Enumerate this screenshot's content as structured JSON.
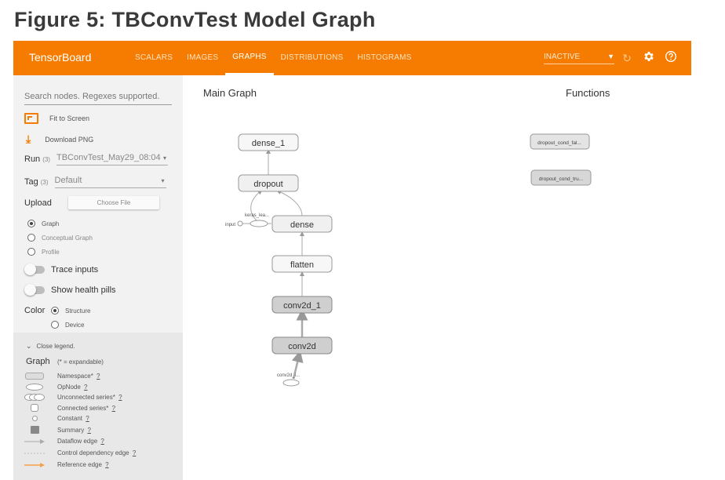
{
  "figure_title": "Figure 5:  TBConvTest Model Graph",
  "topbar": {
    "brand": "TensorBoard",
    "tabs": [
      {
        "label": "SCALARS"
      },
      {
        "label": "IMAGES"
      },
      {
        "label": "GRAPHS"
      },
      {
        "label": "DISTRIBUTIONS"
      },
      {
        "label": "HISTOGRAMS"
      }
    ],
    "active_tab": "GRAPHS",
    "status": "INACTIVE",
    "accent_color": "#f57c00"
  },
  "sidebar": {
    "search_placeholder": "Search nodes. Regexes supported.",
    "fit_to_screen": "Fit to Screen",
    "download_png": "Download PNG",
    "run_label": "Run",
    "run_count": "(3)",
    "run_value": "TBConvTest_May29_08:04",
    "tag_label": "Tag",
    "tag_count": "(3)",
    "tag_value": "Default",
    "upload_label": "Upload",
    "choose_file": "Choose File",
    "graph_types": [
      "Graph",
      "Conceptual Graph",
      "Profile"
    ],
    "selected_graph_type": "Graph",
    "trace_inputs": "Trace inputs",
    "health_pills": "Show health pills",
    "color_label": "Color",
    "color_options": [
      "Structure",
      "Device"
    ],
    "selected_color": "Structure"
  },
  "legend": {
    "toggle": "Close legend.",
    "title": "Graph",
    "note": "(* = expandable)",
    "items": [
      {
        "text": "Namespace*",
        "icon": "namespace-icon"
      },
      {
        "text": "OpNode",
        "icon": "opnode-icon"
      },
      {
        "text": "Unconnected series*",
        "icon": "unconnected-series-icon"
      },
      {
        "text": "Connected series*",
        "icon": "connected-series-icon"
      },
      {
        "text": "Constant",
        "icon": "constant-icon"
      },
      {
        "text": "Summary",
        "icon": "summary-icon"
      },
      {
        "text": "Dataflow edge",
        "icon": "dataflow-edge-icon"
      },
      {
        "text": "Control dependency edge",
        "icon": "control-edge-icon"
      },
      {
        "text": "Reference edge",
        "icon": "reference-edge-icon"
      }
    ],
    "help": "?"
  },
  "graph": {
    "main_title": "Main Graph",
    "functions_title": "Functions",
    "nodes": {
      "dense_1": "dense_1",
      "dropout": "dropout",
      "dense": "dense",
      "flatten": "flatten",
      "conv2d_1": "conv2d_1",
      "conv2d": "conv2d",
      "keras_learning": "keras_lea...",
      "input": "input",
      "conv2d_input": "conv2d_i..."
    },
    "functions": [
      "dropout_cond_fal...",
      "dropout_cond_tru..."
    ]
  }
}
